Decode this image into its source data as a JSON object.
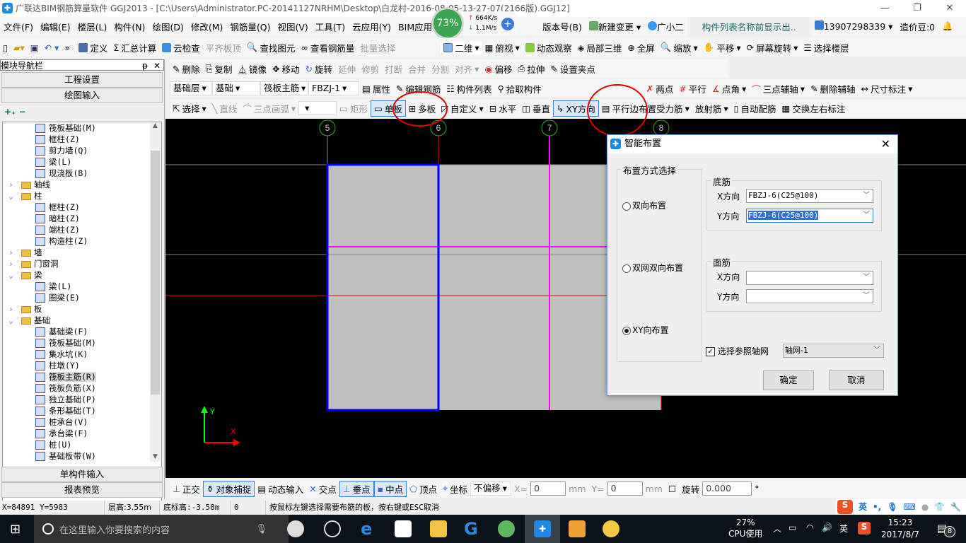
{
  "title": "广联达BIM钢筋算量软件 GGJ2013 - [C:\\Users\\Administrator.PC-20141127NRHM\\Desktop\\白龙村-2016-08-05-13-27-07(2166版).GGJ12]",
  "net_widget": {
    "percent": "73%",
    "up": "664K/s",
    "down": "1.1M/s"
  },
  "menu": [
    "文件(F)",
    "编辑(E)",
    "楼层(L)",
    "构件(N)",
    "绘图(D)",
    "修改(M)",
    "钢筋量(Q)",
    "视图(V)",
    "工具(T)",
    "云应用(Y)",
    "BIM应用(I)",
    "在"
  ],
  "menu_right": {
    "version": "版本号(B)",
    "new_change": "新建变更",
    "assistant": "广小二",
    "tip": "构件列表名称前显示出..",
    "phone": "13907298339",
    "beans": "造价豆:0"
  },
  "toolbar1": [
    "定义",
    "汇总计算",
    "云检查",
    "平齐板顶",
    "查找图元",
    "查看钢筋量",
    "批量选择",
    "二维",
    "俯视",
    "动态观察",
    "局部三维",
    "全屏",
    "缩放",
    "平移",
    "屏幕旋转",
    "选择楼层"
  ],
  "toolbar2": [
    "删除",
    "复制",
    "镜像",
    "移动",
    "旋转",
    "延伸",
    "修剪",
    "打断",
    "合并",
    "分割",
    "对齐",
    "偏移",
    "拉伸",
    "设置夹点"
  ],
  "toolbar3": {
    "floor": "基础层",
    "category": "基础",
    "type": "筏板主筋",
    "item": "FBZJ-1",
    "buttons": [
      "属性",
      "编辑钢筋",
      "构件列表",
      "拾取构件"
    ],
    "right": [
      "两点",
      "平行",
      "点角",
      "三点辅轴",
      "删除辅轴",
      "尺寸标注"
    ]
  },
  "toolbar4": [
    "选择",
    "直线",
    "三点画弧",
    "矩形",
    "单板",
    "多板",
    "自定义",
    "水平",
    "垂直",
    "XY方向",
    "平行边布置受力筋",
    "放射筋",
    "自动配筋",
    "交换左右标注"
  ],
  "nav": {
    "title": "模块导航栏",
    "project": "工程设置",
    "draw": "绘图输入",
    "single": "单构件输入",
    "report": "报表预览",
    "tree": [
      {
        "label": "筏板基础(M)",
        "level": 2
      },
      {
        "label": "框柱(Z)",
        "level": 2
      },
      {
        "label": "剪力墙(Q)",
        "level": 2
      },
      {
        "label": "梁(L)",
        "level": 2
      },
      {
        "label": "现浇板(B)",
        "level": 2
      },
      {
        "label": "轴线",
        "level": 1,
        "folder": true,
        "open": false
      },
      {
        "label": "柱",
        "level": 1,
        "folder": true,
        "open": true
      },
      {
        "label": "框柱(Z)",
        "level": 2
      },
      {
        "label": "暗柱(Z)",
        "level": 2
      },
      {
        "label": "端柱(Z)",
        "level": 2
      },
      {
        "label": "构造柱(Z)",
        "level": 2
      },
      {
        "label": "墙",
        "level": 1,
        "folder": true,
        "open": false
      },
      {
        "label": "门窗洞",
        "level": 1,
        "folder": true,
        "open": false
      },
      {
        "label": "梁",
        "level": 1,
        "folder": true,
        "open": true
      },
      {
        "label": "梁(L)",
        "level": 2
      },
      {
        "label": "圈梁(E)",
        "level": 2
      },
      {
        "label": "板",
        "level": 1,
        "folder": true,
        "open": false
      },
      {
        "label": "基础",
        "level": 1,
        "folder": true,
        "open": true
      },
      {
        "label": "基础梁(F)",
        "level": 2
      },
      {
        "label": "筏板基础(M)",
        "level": 2
      },
      {
        "label": "集水坑(K)",
        "level": 2
      },
      {
        "label": "柱墩(Y)",
        "level": 2
      },
      {
        "label": "筏板主筋(R)",
        "level": 2,
        "selected": true
      },
      {
        "label": "筏板负筋(X)",
        "level": 2
      },
      {
        "label": "独立基础(P)",
        "level": 2
      },
      {
        "label": "条形基础(T)",
        "level": 2
      },
      {
        "label": "桩承台(V)",
        "level": 2
      },
      {
        "label": "承台梁(F)",
        "level": 2
      },
      {
        "label": "桩(U)",
        "level": 2
      },
      {
        "label": "基础板带(W)",
        "level": 2
      }
    ]
  },
  "axes": [
    "5",
    "6",
    "7",
    "8"
  ],
  "dialog": {
    "title": "智能布置",
    "mode_group": "布置方式选择",
    "modes": [
      "双向布置",
      "双网双向布置",
      "XY向布置"
    ],
    "selected_mode": 2,
    "bottom": {
      "label": "底筋",
      "x_label": "X方向",
      "x_value": "FBZJ-6(C25@100)",
      "y_label": "Y方向",
      "y_value": "FBZJ-6(C25@100)"
    },
    "top": {
      "label": "面筋",
      "x_label": "X方向",
      "x_value": "",
      "y_label": "Y方向",
      "y_value": ""
    },
    "ref_axis_label": "选择参照轴网",
    "ref_axis_checked": true,
    "ref_axis_value": "轴网-1",
    "ok": "确定",
    "cancel": "取消"
  },
  "snapbar": {
    "items": [
      "正交",
      "对象捕捉",
      "动态输入",
      "交点",
      "垂点",
      "中点",
      "顶点",
      "坐标"
    ],
    "offset": "不偏移",
    "x_label": "X=",
    "x": "0",
    "unit": "mm",
    "y_label": "Y=",
    "y": "0",
    "rotate": "旋转",
    "angle": "0.000",
    "deg": "°"
  },
  "status": {
    "coords": "X=84891 Y=5983",
    "floor_height": "层高:3.55m",
    "bottom_elev": "底标高:-3.58m",
    "zero": "0",
    "hint": "按鼠标左键选择需要布筋的板，按右键或ESC取消"
  },
  "ime": {
    "lang": "英"
  },
  "taskbar": {
    "search": "在这里输入你要搜索的内容",
    "cpu": "27%",
    "cpu_label": "CPU使用",
    "lang": "英",
    "time": "15:23",
    "date": "2017/8/7",
    "notifications": "8"
  },
  "colors": {
    "canvas": "#000000",
    "slab": "#c0c0c0",
    "selected": "#0000ff",
    "axis_red": "#ff0000",
    "axis_magenta": "#ff00ff",
    "highlight_circle": "#e00000"
  }
}
